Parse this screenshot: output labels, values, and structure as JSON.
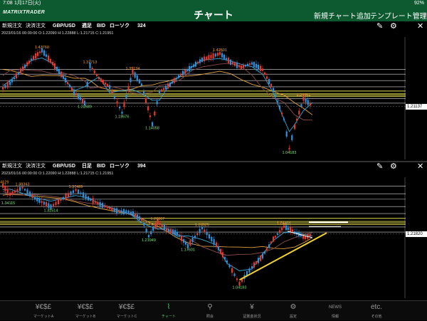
{
  "status": {
    "time": "7:08",
    "date": "1月17日(火)",
    "battery": "92%"
  },
  "nav": {
    "logo": "MATRIXTRADER",
    "title": "チャート",
    "add_chart": "新規チャート追加",
    "template": "テンプレート管理"
  },
  "panels": [
    {
      "new_order": "新規注文",
      "settle_order": "決済注文",
      "pair": "GBP/USD",
      "timeframe": "週足",
      "price_type": "BID",
      "chart_type": "ローソク",
      "count": "324",
      "ohlc": "2023/01/16 00:00:00    O:1.22090  H:1.22888  L:1.21715  C:1.21951",
      "current_price": "1.21137",
      "hlines": [
        1.3615,
        1.342,
        1.316,
        1.291,
        1.274,
        1.263,
        1.2575,
        1.252,
        1.243,
        1.225
      ],
      "labels": [
        {
          "text": "1.43760",
          "x": 0.11,
          "y": 1.4376,
          "pos": "above",
          "color": "#f59b36"
        },
        {
          "text": "1.37713",
          "x": 0.245,
          "y": 1.3771,
          "pos": "above",
          "color": "#f59b36"
        },
        {
          "text": "1.35134",
          "x": 0.365,
          "y": 1.3513,
          "pos": "above",
          "color": "#f59b36"
        },
        {
          "text": "1.42501",
          "x": 0.61,
          "y": 1.425,
          "pos": "above",
          "color": "#f59b36"
        },
        {
          "text": "1.24461",
          "x": 0.845,
          "y": 1.2446,
          "pos": "above",
          "color": "#f59b36"
        },
        {
          "text": "1.22589",
          "x": 0.23,
          "y": 1.2259,
          "pos": "below",
          "color": "#7fe07f"
        },
        {
          "text": "1.18676",
          "x": 0.335,
          "y": 1.1868,
          "pos": "below",
          "color": "#7fe07f"
        },
        {
          "text": "1.14058",
          "x": 0.42,
          "y": 1.1406,
          "pos": "below",
          "color": "#7fe07f"
        },
        {
          "text": "1.04183",
          "x": 0.805,
          "y": 1.0418,
          "pos": "below",
          "color": "#7fe07f"
        }
      ],
      "path": [
        [
          0,
          1.286
        ],
        [
          0.02,
          1.305
        ],
        [
          0.05,
          1.355
        ],
        [
          0.08,
          1.4
        ],
        [
          0.11,
          1.4376
        ],
        [
          0.14,
          1.385
        ],
        [
          0.17,
          1.33
        ],
        [
          0.2,
          1.27
        ],
        [
          0.23,
          1.2259
        ],
        [
          0.245,
          1.3771
        ],
        [
          0.27,
          1.325
        ],
        [
          0.3,
          1.29
        ],
        [
          0.335,
          1.1868
        ],
        [
          0.365,
          1.3513
        ],
        [
          0.39,
          1.3
        ],
        [
          0.42,
          1.1406
        ],
        [
          0.44,
          1.27
        ],
        [
          0.47,
          1.3
        ],
        [
          0.5,
          1.34
        ],
        [
          0.53,
          1.37
        ],
        [
          0.56,
          1.4
        ],
        [
          0.61,
          1.425
        ],
        [
          0.64,
          1.39
        ],
        [
          0.67,
          1.37
        ],
        [
          0.7,
          1.385
        ],
        [
          0.73,
          1.36
        ],
        [
          0.76,
          1.28
        ],
        [
          0.79,
          1.16
        ],
        [
          0.805,
          1.0418
        ],
        [
          0.82,
          1.13
        ],
        [
          0.845,
          1.2446
        ],
        [
          0.87,
          1.2114
        ]
      ],
      "ylim": [
        1.01,
        1.48
      ]
    },
    {
      "new_order": "新規注文",
      "settle_order": "決済注文",
      "pair": "GBP/USD",
      "timeframe": "日足",
      "price_type": "BID",
      "chart_type": "ローソク",
      "count": "394",
      "ohlc": "2023/01/16 00:00:00    O:1.22090  H:1.22888  L:1.21715  C:1.21951",
      "current_price": "1.21820",
      "hlines": [
        1.389,
        1.3615,
        1.342,
        1.316,
        1.291,
        1.274,
        1.263,
        1.2575,
        1.252,
        1.243,
        1.225
      ],
      "labels": [
        {
          "text": "1.4129",
          "x": 0.0,
          "y": 1.3905,
          "pos": "above",
          "color": "#f59b36"
        },
        {
          "text": "1.38343",
          "x": 0.055,
          "y": 1.3834,
          "pos": "above",
          "color": "#f59b36"
        },
        {
          "text": "1.37485",
          "x": 0.205,
          "y": 1.3749,
          "pos": "above",
          "color": "#f59b36"
        },
        {
          "text": "1.26067",
          "x": 0.435,
          "y": 1.2607,
          "pos": "above",
          "color": "#f59b36"
        },
        {
          "text": "1.23929",
          "x": 0.56,
          "y": 1.2393,
          "pos": "above",
          "color": "#f59b36"
        },
        {
          "text": "1.24461",
          "x": 0.79,
          "y": 1.2446,
          "pos": "above",
          "color": "#f59b36"
        },
        {
          "text": "1.34115",
          "x": 0.015,
          "y": 1.3412,
          "pos": "below",
          "color": "#7fe07f"
        },
        {
          "text": "1.31514",
          "x": 0.135,
          "y": 1.3151,
          "pos": "below",
          "color": "#7fe07f"
        },
        {
          "text": "1.21049",
          "x": 0.41,
          "y": 1.2105,
          "pos": "below",
          "color": "#7fe07f"
        },
        {
          "text": "1.17601",
          "x": 0.52,
          "y": 1.176,
          "pos": "below",
          "color": "#7fe07f"
        },
        {
          "text": "1.04183",
          "x": 0.665,
          "y": 1.0418,
          "pos": "below",
          "color": "#7fe07f"
        }
      ],
      "path": [
        [
          0,
          1.39
        ],
        [
          0.02,
          1.36
        ],
        [
          0.055,
          1.3834
        ],
        [
          0.09,
          1.345
        ],
        [
          0.135,
          1.3151
        ],
        [
          0.17,
          1.345
        ],
        [
          0.205,
          1.3749
        ],
        [
          0.24,
          1.345
        ],
        [
          0.28,
          1.32
        ],
        [
          0.32,
          1.3
        ],
        [
          0.36,
          1.295
        ],
        [
          0.39,
          1.27
        ],
        [
          0.41,
          1.2105
        ],
        [
          0.435,
          1.2607
        ],
        [
          0.46,
          1.235
        ],
        [
          0.49,
          1.22
        ],
        [
          0.52,
          1.176
        ],
        [
          0.56,
          1.2393
        ],
        [
          0.6,
          1.18
        ],
        [
          0.63,
          1.12
        ],
        [
          0.665,
          1.0418
        ],
        [
          0.7,
          1.1
        ],
        [
          0.73,
          1.14
        ],
        [
          0.76,
          1.2
        ],
        [
          0.79,
          1.2446
        ],
        [
          0.82,
          1.225
        ],
        [
          0.85,
          1.205
        ],
        [
          0.87,
          1.2182
        ]
      ],
      "ylim": [
        1.0,
        1.41
      ]
    }
  ],
  "tabs": [
    {
      "label": "マーケットA",
      "icon": "¥€$£"
    },
    {
      "label": "マーケットB",
      "icon": "¥€$£"
    },
    {
      "label": "マーケットC",
      "icon": "¥€$£"
    },
    {
      "label": "チャート",
      "icon": "⌇"
    },
    {
      "label": "照会",
      "icon": "⚲"
    },
    {
      "label": "証拠金状況",
      "icon": "¥"
    },
    {
      "label": "設定",
      "icon": "⚙"
    },
    {
      "label": "情報",
      "icon": "NEWS"
    },
    {
      "label": "その他",
      "icon": "etc."
    }
  ],
  "colors": {
    "nav_bg": "#0d5a31",
    "accent": "#4cc96b",
    "hline": "#ffffff",
    "hline_yellow": "#d8d24a",
    "ma_short": "#3aa7d6",
    "ma_mid": "#8a4b4b",
    "ma_long": "#e0a040",
    "trendline": "#f1d22b"
  }
}
